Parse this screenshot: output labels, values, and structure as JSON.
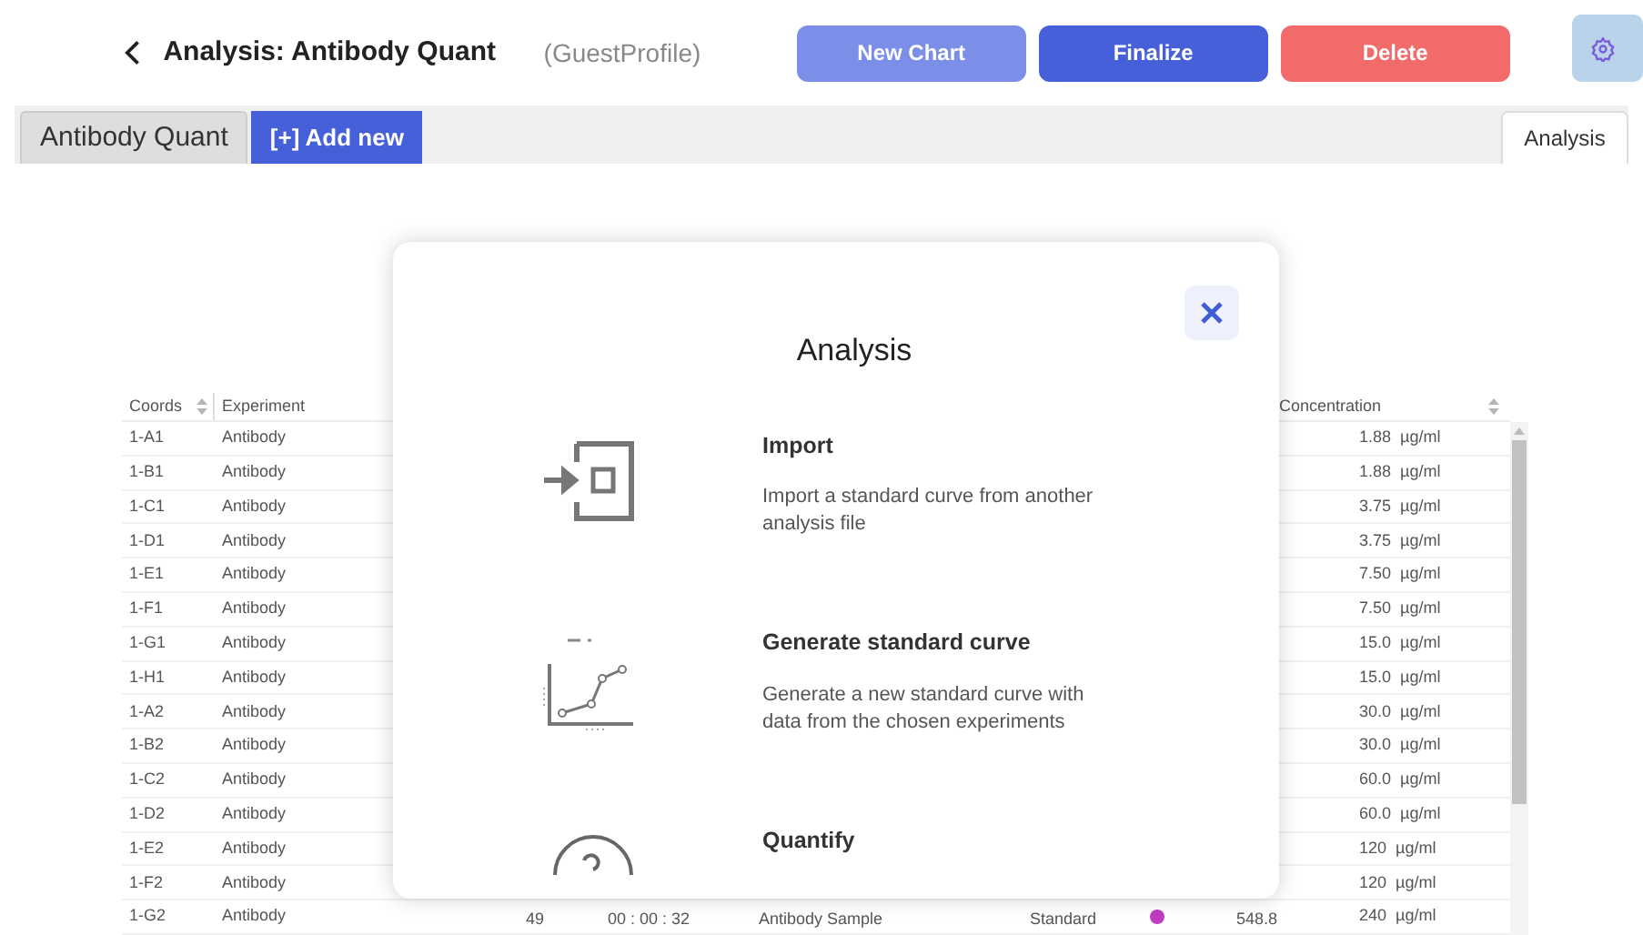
{
  "header": {
    "title": "Analysis: Antibody Quant",
    "profile": "(GuestProfile)",
    "buttons": [
      {
        "label": "New Chart",
        "kind": "light"
      },
      {
        "label": "Finalize",
        "kind": "primary"
      },
      {
        "label": "Delete",
        "kind": "danger"
      }
    ]
  },
  "tabs": [
    {
      "label": "Antibody Quant",
      "kind": "doc",
      "selected": true
    },
    {
      "label": "[+] Add new",
      "kind": "add",
      "selected": false
    }
  ],
  "side_tab": {
    "label": "Analysis",
    "selected": true
  },
  "table": {
    "columns": [
      "Coords",
      "Experiment",
      "Concentration"
    ],
    "rows": [
      {
        "coords": "1-A1",
        "experiment": "Antibody",
        "concentration": "1.88  µg/ml"
      },
      {
        "coords": "1-B1",
        "experiment": "Antibody",
        "concentration": "1.88  µg/ml"
      },
      {
        "coords": "1-C1",
        "experiment": "Antibody",
        "concentration": "3.75  µg/ml"
      },
      {
        "coords": "1-D1",
        "experiment": "Antibody",
        "concentration": "3.75  µg/ml"
      },
      {
        "coords": "1-E1",
        "experiment": "Antibody",
        "concentration": "7.50  µg/ml"
      },
      {
        "coords": "1-F1",
        "experiment": "Antibody",
        "concentration": "7.50  µg/ml"
      },
      {
        "coords": "1-G1",
        "experiment": "Antibody",
        "concentration": "15.0  µg/ml"
      },
      {
        "coords": "1-H1",
        "experiment": "Antibody",
        "concentration": "15.0  µg/ml"
      },
      {
        "coords": "1-A2",
        "experiment": "Antibody",
        "concentration": "30.0  µg/ml"
      },
      {
        "coords": "1-B2",
        "experiment": "Antibody",
        "concentration": "30.0  µg/ml"
      },
      {
        "coords": "1-C2",
        "experiment": "Antibody",
        "concentration": "60.0  µg/ml"
      },
      {
        "coords": "1-D2",
        "experiment": "Antibody",
        "concentration": "60.0  µg/ml"
      },
      {
        "coords": "1-E2",
        "experiment": "Antibody",
        "concentration": "120  µg/ml"
      },
      {
        "coords": "1-F2",
        "experiment": "Antibody",
        "concentration": "120  µg/ml"
      },
      {
        "coords": "1-G2",
        "experiment": "Antibody",
        "column_3": "49",
        "column_4": "00 : 00 : 32",
        "column_5": "Antibody Sample",
        "column_6": "Standard",
        "color": "#c03cc0",
        "column_8": "548.8",
        "concentration": "240  µg/ml"
      }
    ]
  },
  "dialog": {
    "title": "Analysis",
    "options": [
      {
        "kind": "import",
        "title": "Import",
        "description": "Import a standard curve from another analysis file"
      },
      {
        "kind": "curve",
        "title": "Generate standard curve",
        "description": "Generate a new standard curve with data from the chosen experiments"
      },
      {
        "kind": "quantify",
        "title": "Quantify"
      }
    ]
  }
}
